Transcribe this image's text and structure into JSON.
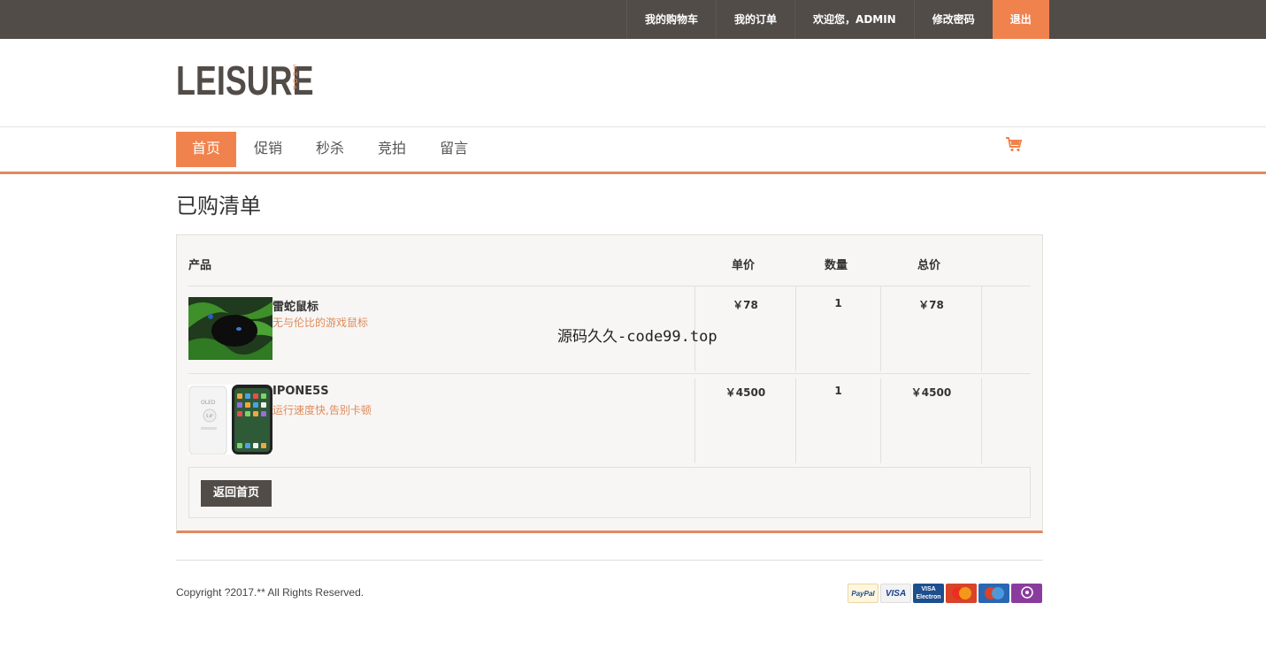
{
  "topbar": {
    "links": [
      "我的购物车",
      "我的订单",
      "欢迎您，ADMIN",
      "修改密码"
    ],
    "logout": "退出"
  },
  "logo": {
    "main": "LEISURE",
    "sub": "SHOP"
  },
  "nav": {
    "items": [
      "首页",
      "促销",
      "秒杀",
      "竞拍",
      "留言"
    ],
    "cart_icon": "shopping-cart-icon"
  },
  "page": {
    "title": "已购清单"
  },
  "table": {
    "headers": {
      "product": "产品",
      "price": "单价",
      "qty": "数量",
      "total": "总价"
    },
    "rows": [
      {
        "name": "雷蛇鼠标",
        "desc": "无与伦比的游戏鼠标",
        "price": "￥78",
        "qty": "1",
        "total": "￥78"
      },
      {
        "name": "IPONE5S",
        "desc": "运行速度快,告别卡顿",
        "price": "￥4500",
        "qty": "1",
        "total": "￥4500"
      }
    ],
    "back_label": "返回首页"
  },
  "watermark": "源码久久-code99.top",
  "footer": {
    "copyright": "Copyright ?2017.** All Rights Reserved.",
    "payments": [
      "PayPal",
      "VISA",
      "VISA",
      "Electron",
      "MasterCard",
      "Maestro",
      "SOLO"
    ]
  },
  "colors": {
    "accent": "#f0834d",
    "dark": "#524c48"
  }
}
